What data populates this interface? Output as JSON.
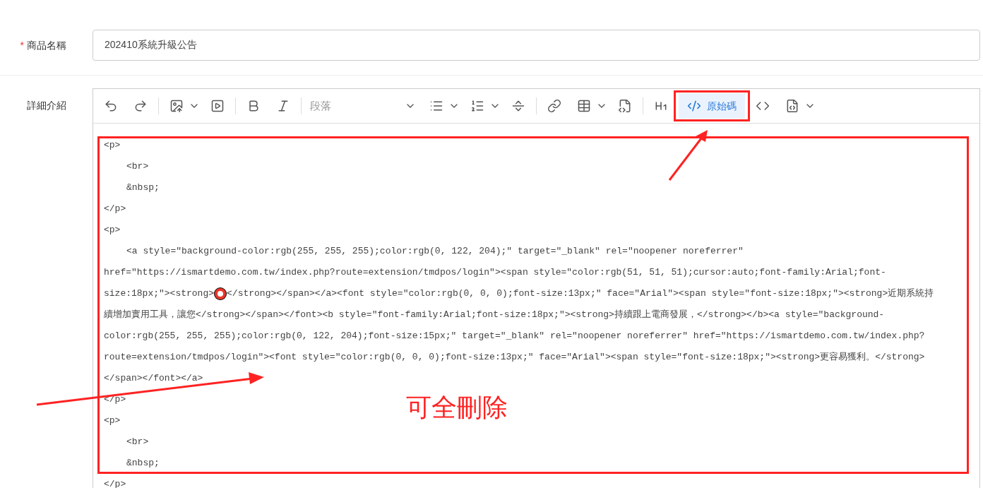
{
  "fields": [
    {
      "label": "商品名稱",
      "required_mark": "*",
      "value": "202410系統升級公告"
    }
  ],
  "editor": {
    "label": "詳細介紹",
    "toolbar": {
      "paragraph_select": "段落",
      "source_button": {
        "label": "原始碼",
        "selected": true
      }
    },
    "blocks": [
      {
        "open": "<p>",
        "children": [
          {
            "lines": [
              [
                "<br>"
              ]
            ]
          },
          {
            "lines": [
              [
                "&nbsp;"
              ]
            ]
          }
        ],
        "close": "</p>"
      },
      {
        "open": "<p>",
        "children": [
          {
            "lines": [
              [
                "<a style=\"background-color:rgb(255, 255, 255);color:rgb(0, 122, 204);\" target=\"_blank\" rel=\"noopener noreferrer\""
              ],
              [
                "href=\"https://ismartdemo.com.tw/index.php?route=extension/tmdpos/login\"><span style=\"color:rgb(51, 51, 51);cursor:auto;font-family:Arial;font-"
              ],
              [
                "size:18px;\"><strong>",
                "</strong></span></a><font style=\"color:rgb(0, 0, 0);font-size:13px;\" face=\"Arial\"><span style=\"font-size:18px;\"><strong>近期系統持"
              ],
              [
                "續增加實用工具，讓您</strong></span></font><b style=\"font-family:Arial;font-size:18px;\"><strong>持續跟上電商發展，</strong></b><a style=\"background-"
              ],
              [
                "color:rgb(255, 255, 255);color:rgb(0, 122, 204);font-size:15px;\" target=\"_blank\" rel=\"noopener noreferrer\" href=\"https://ismartdemo.com.tw/index.php?"
              ],
              [
                "route=extension/tmdpos/login\"><font style=\"color:rgb(0, 0, 0);font-size:13px;\" face=\"Arial\"><span style=\"font-size:18px;\"><strong>更容易獲利。</strong>"
              ],
              [
                "</span></font></a>"
              ]
            ]
          }
        ],
        "close": "</p>"
      },
      {
        "open": "<p>",
        "children": [
          {
            "lines": [
              [
                "<br>"
              ]
            ]
          },
          {
            "lines": [
              [
                "&nbsp;"
              ]
            ]
          }
        ],
        "close": "</p>"
      }
    ]
  },
  "annotation": {
    "text": "可全刪除"
  }
}
